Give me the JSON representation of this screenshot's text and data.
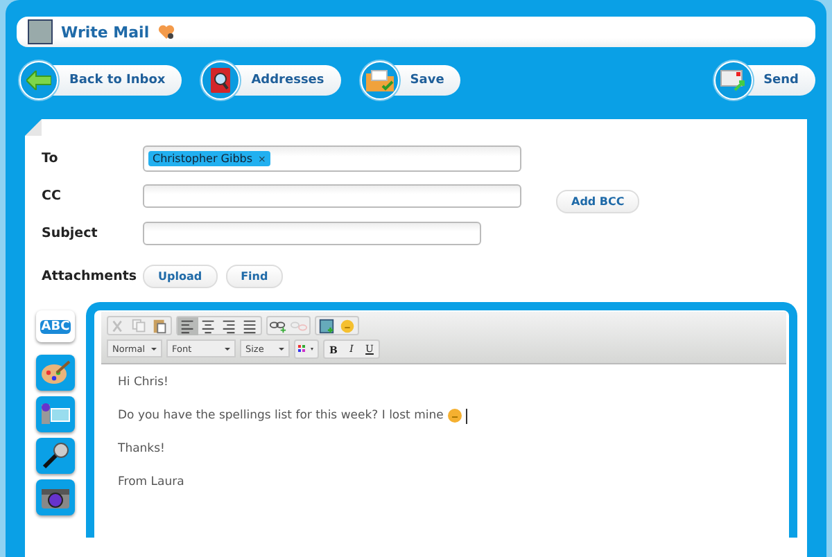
{
  "window": {
    "title": "Write Mail"
  },
  "actions": [
    {
      "label": "Back to Inbox",
      "kind": "back"
    },
    {
      "label": "Addresses",
      "kind": "addresses"
    },
    {
      "label": "Save",
      "kind": "save"
    },
    {
      "label": "Send",
      "kind": "send"
    }
  ],
  "form": {
    "to": {
      "label": "To",
      "recipients": [
        {
          "name": "Christopher Gibbs",
          "remove": "×"
        }
      ]
    },
    "cc": {
      "label": "CC",
      "button": "Add BCC"
    },
    "subject": {
      "label": "Subject"
    },
    "attachments": {
      "label": "Attachments",
      "buttons": [
        "Upload",
        "Find"
      ]
    }
  },
  "tools": [
    {
      "kind": "text",
      "label": "ABC",
      "selected": true
    },
    {
      "kind": "paint",
      "selected": false
    },
    {
      "kind": "video",
      "selected": false
    },
    {
      "kind": "microphone",
      "selected": false
    },
    {
      "kind": "camera",
      "selected": false
    }
  ],
  "editor": {
    "toolbar": [
      {
        "kind": "cut",
        "disabled": true,
        "selected": false
      },
      {
        "kind": "copy",
        "disabled": true,
        "selected": false
      },
      {
        "kind": "paste",
        "disabled": false,
        "selected": false
      },
      {
        "kind": "align-left",
        "disabled": false,
        "selected": true
      },
      {
        "kind": "align-center",
        "disabled": false,
        "selected": false
      },
      {
        "kind": "align-right",
        "disabled": false,
        "selected": false
      },
      {
        "kind": "justify",
        "disabled": false,
        "selected": false
      },
      {
        "kind": "link",
        "disabled": false,
        "selected": false
      },
      {
        "kind": "unlink",
        "disabled": true,
        "selected": false
      },
      {
        "kind": "image",
        "disabled": false,
        "selected": false
      },
      {
        "kind": "smiley",
        "disabled": false,
        "selected": false
      }
    ],
    "dropdowns": [
      "Normal",
      "Font",
      "Size"
    ],
    "styles": [
      "B",
      "I",
      "U"
    ],
    "lines": [
      [
        {
          "kind": "text",
          "text": "Hi Chris!"
        }
      ],
      [
        {
          "kind": "text",
          "text": "Do you have the spellings list for this week? I lost mine"
        },
        {
          "kind": "emoji"
        },
        {
          "kind": "cursor"
        }
      ],
      [
        {
          "kind": "text",
          "text": "Thanks!"
        }
      ],
      [
        {
          "kind": "text",
          "text": "From Laura"
        }
      ]
    ]
  }
}
